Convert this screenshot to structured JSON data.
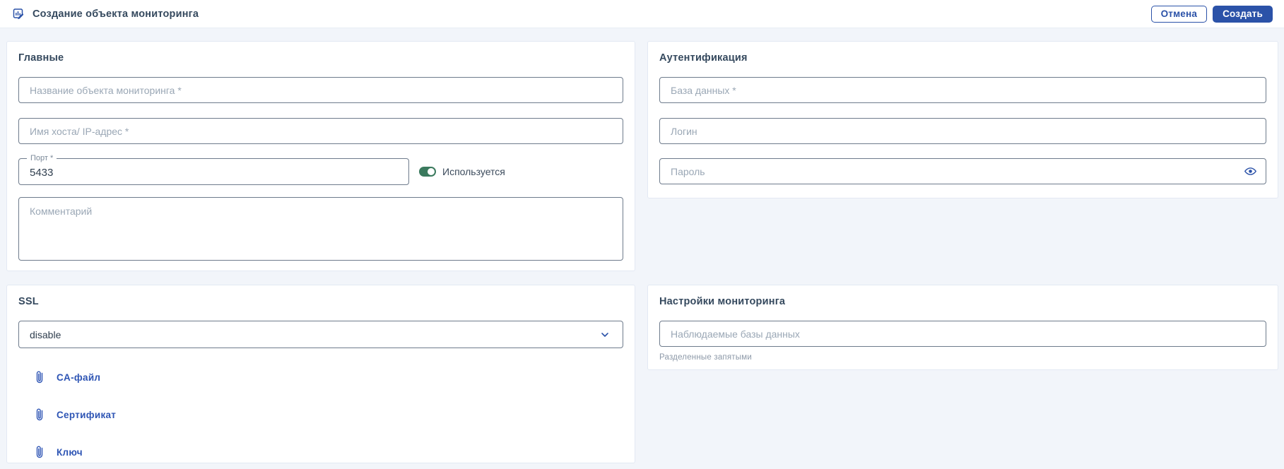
{
  "header": {
    "title": "Создание объекта мониторинга",
    "cancel_label": "Отмена",
    "create_label": "Создать"
  },
  "cards": {
    "main": {
      "title": "Главные",
      "name_placeholder": "Название объекта мониторинга *",
      "host_placeholder": "Имя хоста/ IP-адрес *",
      "port_label": "Порт *",
      "port_value": "5433",
      "toggle_label": "Используется",
      "toggle_state": "on",
      "comment_placeholder": "Комментарий"
    },
    "auth": {
      "title": "Аутентификация",
      "database_placeholder": "База данных *",
      "login_placeholder": "Логин",
      "password_placeholder": "Пароль"
    },
    "ssl": {
      "title": "SSL",
      "mode_value": "disable",
      "attachments": [
        {
          "label": "CA-файл"
        },
        {
          "label": "Сертификат"
        },
        {
          "label": "Ключ"
        }
      ]
    },
    "monitoring": {
      "title": "Настройки мониторинга",
      "databases_placeholder": "Наблюдаемые базы данных",
      "helper": "Разделенные запятыми"
    }
  },
  "icons": {
    "header": "document-chart-edit-icon",
    "password": "eye-icon",
    "select": "chevron-down-icon",
    "attachment": "paperclip-icon"
  },
  "colors": {
    "accent": "#2b52a8",
    "link": "#2d54b4",
    "toggle_on": "#3b7a5e",
    "page_background": "#f2f5fa"
  }
}
